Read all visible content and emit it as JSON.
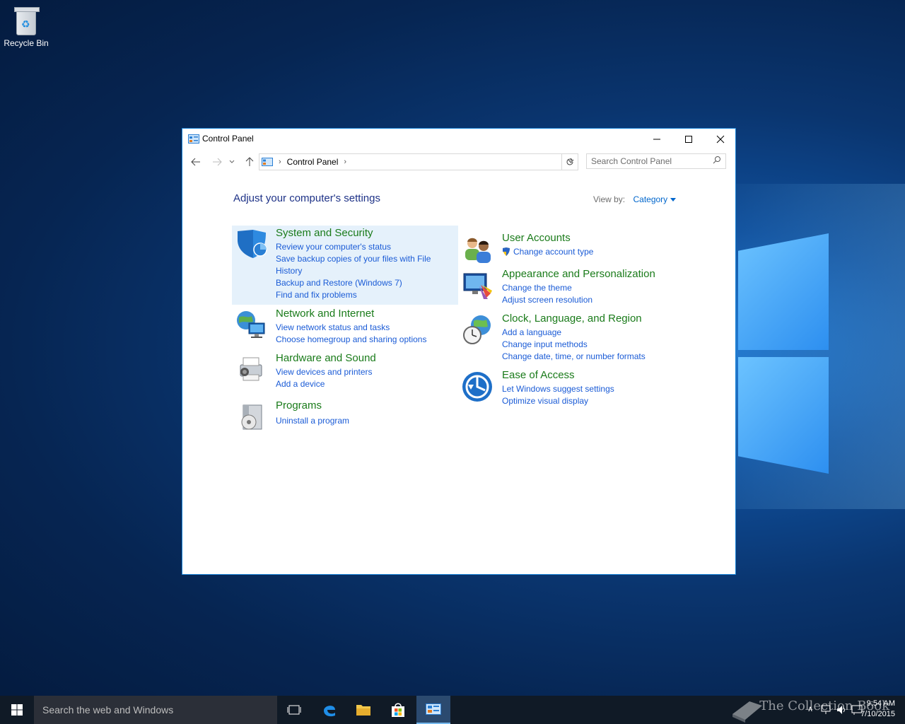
{
  "desktop": {
    "recycle_bin_label": "Recycle Bin"
  },
  "window": {
    "title": "Control Panel",
    "controls": {
      "minimize": "—",
      "maximize": "☐",
      "close": "✕"
    },
    "address": {
      "crumb": "Control Panel"
    },
    "search_placeholder": "Search Control Panel",
    "heading": "Adjust your computer's settings",
    "view_by_label": "View by:",
    "view_by_value": "Category",
    "categories": {
      "system_security": {
        "title": "System and Security",
        "links": [
          "Review your computer's status",
          "Save backup copies of your files with File History",
          "Backup and Restore (Windows 7)",
          "Find and fix problems"
        ]
      },
      "network": {
        "title": "Network and Internet",
        "links": [
          "View network status and tasks",
          "Choose homegroup and sharing options"
        ]
      },
      "hardware": {
        "title": "Hardware and Sound",
        "links": [
          "View devices and printers",
          "Add a device"
        ]
      },
      "programs": {
        "title": "Programs",
        "links": [
          "Uninstall a program"
        ]
      },
      "users": {
        "title": "User Accounts",
        "links": [
          "Change account type"
        ]
      },
      "appearance": {
        "title": "Appearance and Personalization",
        "links": [
          "Change the theme",
          "Adjust screen resolution"
        ]
      },
      "clock": {
        "title": "Clock, Language, and Region",
        "links": [
          "Add a language",
          "Change input methods",
          "Change date, time, or number formats"
        ]
      },
      "ease": {
        "title": "Ease of Access",
        "links": [
          "Let Windows suggest settings",
          "Optimize visual display"
        ]
      }
    }
  },
  "taskbar": {
    "search_placeholder": "Search the web and Windows",
    "time": "9:54 AM",
    "date": "7/10/2015",
    "watermark": "The Collection Book"
  },
  "colors": {
    "accent": "#1883d7",
    "category_title": "#1a7b1a",
    "link": "#1a5bd6",
    "heading": "#1e3287"
  }
}
